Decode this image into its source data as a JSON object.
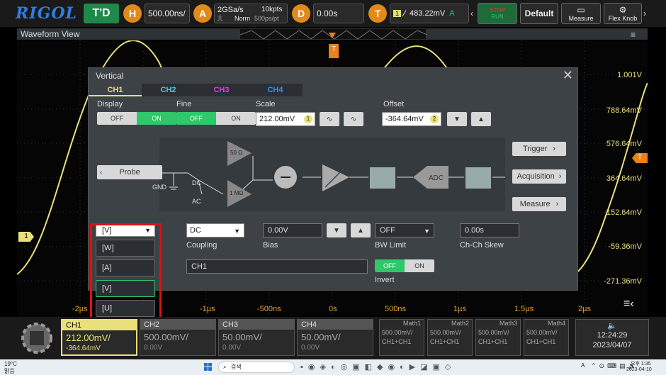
{
  "topbar": {
    "logo": "RIGOL",
    "trigger_mode": "T'D",
    "h_label": "H",
    "timebase": "500.00ns/",
    "a_label": "A",
    "sample_rate": "2GSa/s",
    "mem_depth": "10kpts",
    "acq_mode": "Norm",
    "sample_interval": "500ps/pt",
    "d_label": "D",
    "delay": "0.00s",
    "t_label": "T",
    "trig_source": "1",
    "trig_level": "483.22mV",
    "trig_unit": "A",
    "stop": "STOP",
    "run": "RUN",
    "default": "Default",
    "measure": "Measure",
    "flex_knob": "Flex Knob"
  },
  "waveform": {
    "title": "Waveform View",
    "ch_marker": "1",
    "trig_marker": "T",
    "y_labels": [
      "1.001V",
      "788.64mV",
      "576.64mV",
      "364.64mV",
      "152.64mV",
      "-59.36mV",
      "-271.36mV"
    ],
    "x_labels": [
      "-2µs",
      "-1µs",
      "-500ns",
      "0s",
      "500ns",
      "1µs",
      "1.5µs",
      "2µs"
    ]
  },
  "dialog": {
    "title": "Vertical",
    "tabs": [
      "CH1",
      "CH2",
      "CH3",
      "CH4"
    ],
    "tab_colors": [
      "#e8e07a",
      "#3fd0e6",
      "#e43fe0",
      "#3a8ef0"
    ],
    "display_label": "Display",
    "fine_label": "Fine",
    "scale_label": "Scale",
    "offset_label": "Offset",
    "off": "OFF",
    "on": "ON",
    "scale_value": "212.00mV",
    "scale_knob": "1",
    "offset_value": "-364.64mV",
    "offset_knob": "2",
    "probe": "Probe",
    "gnd": "GND",
    "dc": "DC",
    "ac": "AC",
    "r50": "50 Ω",
    "r1m": "1 MΩ",
    "adc": "ADC",
    "trigger_btn": "Trigger",
    "acquisition_btn": "Acquisition",
    "measure_btn": "Measure",
    "unit_selected": "[V]",
    "unit_options": [
      "[W]",
      "[A]",
      "[V]",
      "[U]"
    ],
    "coupling_value": "DC",
    "coupling_label": "Coupling",
    "bias_value": "0.00V",
    "bias_label": "Bias",
    "bw_value": "OFF",
    "bw_label": "BW Limit",
    "skew_value": "0.00s",
    "skew_label": "Ch-Ch Skew",
    "ch_label_value": "CH1",
    "invert_label": "Invert"
  },
  "bottombar": {
    "channels": [
      {
        "name": "CH1",
        "scale": "212.00mV/",
        "offset": "-364.64mV"
      },
      {
        "name": "CH2",
        "scale": "500.00mV/",
        "offset": "0.00V"
      },
      {
        "name": "CH3",
        "scale": "50.00mV/",
        "offset": "0.00V"
      },
      {
        "name": "CH4",
        "scale": "50.00mV/",
        "offset": "0.00V"
      }
    ],
    "maths": [
      {
        "name": "Math1",
        "scale": "500.00mV/",
        "src": "CH1+CH1"
      },
      {
        "name": "Math2",
        "scale": "500.00mV/",
        "src": "CH1+CH1"
      },
      {
        "name": "Math3",
        "scale": "500.00mV/",
        "src": "CH1+CH1"
      },
      {
        "name": "Math4",
        "scale": "500.00mV/",
        "src": "CH1+CH1"
      }
    ],
    "time": "12:24:29",
    "date": "2023/04/07"
  },
  "taskbar": {
    "weather_temp": "19°C",
    "weather_text": "맑음",
    "search": "검색",
    "lang": "A",
    "clock_time": "오후 1:35",
    "clock_date": "2023-04-10"
  }
}
